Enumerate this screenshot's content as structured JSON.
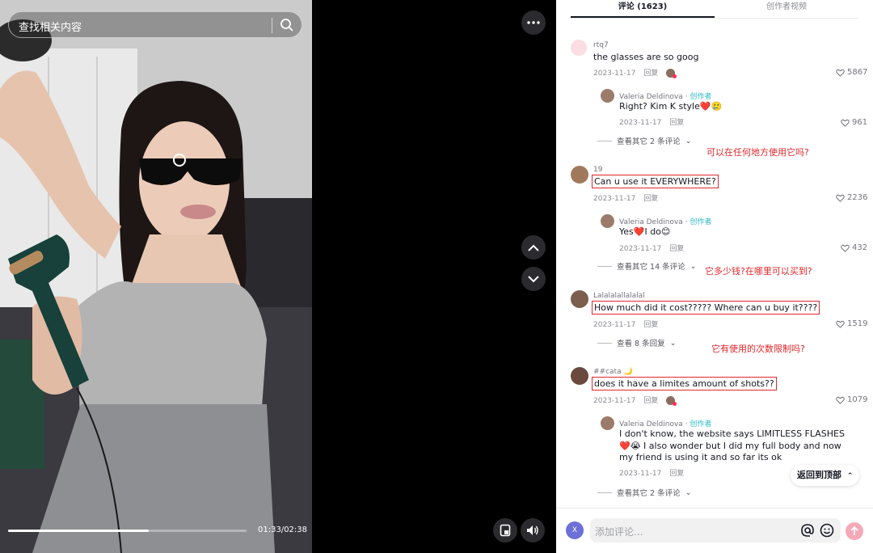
{
  "video": {
    "search_placeholder": "查找相关内容",
    "time": "01:33/02:38",
    "progress_fraction": 0.59
  },
  "tabs": {
    "comments": "评论 (1623)",
    "creator_videos": "创作者视频"
  },
  "creator_tag": "创作者",
  "reply_label": "回复",
  "comments": [
    {
      "user": "rtq7",
      "text": "the glasses are so goog",
      "date": "2023-11-17",
      "likes": "5867",
      "reply": {
        "user": "Valeria  Deldinova",
        "text": "Right? Kim K style❤️🥲",
        "date": "2023-11-17",
        "likes": "961"
      },
      "view_more": "查看其它 2 条评论",
      "annotation": "可以在任何地方使用它吗?"
    },
    {
      "user": "19",
      "text": "Can u use it EVERYWHERE?",
      "date": "2023-11-17",
      "likes": "2236",
      "reply": {
        "user": "Valeria  Deldinova",
        "text": "Yes❤️I do😊",
        "date": "2023-11-17",
        "likes": "432"
      },
      "view_more": "查看其它 14 条评论",
      "annotation": "它多少钱?在哪里可以买到?"
    },
    {
      "user": "Lalalalallalalal",
      "text": "How much did it cost????? Where can u buy it????",
      "date": "2023-11-17",
      "likes": "1519",
      "view_more": "查看 8 条回复",
      "annotation": "它有使用的次数限制吗?"
    },
    {
      "user": "##cata 🌙",
      "text": "does it have a limites amount of shots??",
      "date": "2023-11-17",
      "likes": "1079",
      "reply": {
        "user": "Valeria  Deldinova",
        "text_lines": [
          "I don't know, the website says LIMITLESS FLASHES",
          "❤️😭 I also wonder but I did my full body and now",
          "my friend is using it and so far its ok"
        ],
        "date": "2023-11-17"
      },
      "view_more": "查看其它 2 条评论"
    }
  ],
  "back_to_top": "返回到顶部",
  "input": {
    "placeholder": "添加评论...",
    "user_initial": "X"
  }
}
